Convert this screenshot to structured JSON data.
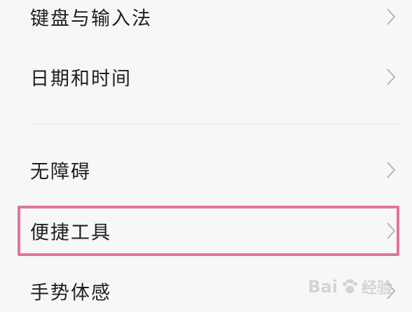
{
  "settings": {
    "items": [
      {
        "label": "键盘与输入法"
      },
      {
        "label": "日期和时间"
      },
      {
        "label": "无障碍"
      },
      {
        "label": "便捷工具"
      },
      {
        "label": "手势体感"
      }
    ]
  },
  "highlight_color": "#e0749c",
  "chevron_icon": "chevron-right-icon",
  "watermark": {
    "text": "Bai",
    "text2": "经验"
  }
}
